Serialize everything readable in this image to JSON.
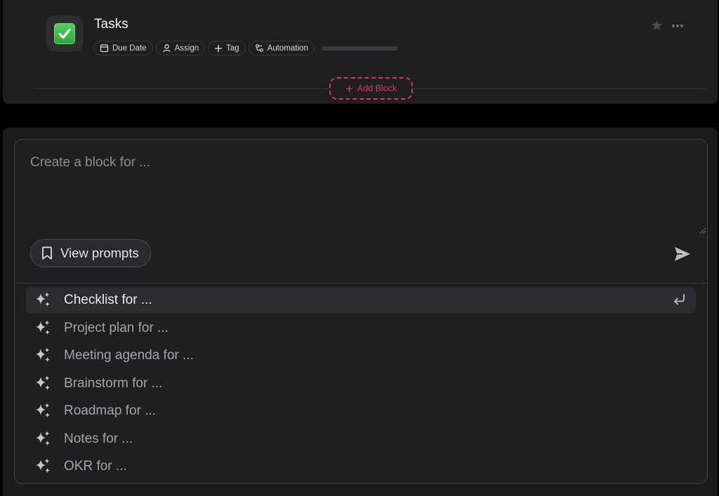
{
  "task_block": {
    "title": "Tasks",
    "chips": [
      {
        "label": "Due Date",
        "icon": "calendar-icon"
      },
      {
        "label": "Assign",
        "icon": "user-icon"
      },
      {
        "label": "Tag",
        "icon": "plus-icon"
      },
      {
        "label": "Automation",
        "icon": "automation-icon"
      }
    ],
    "add_block_label": "Add Block"
  },
  "composer": {
    "placeholder": "Create a block for ...",
    "view_prompts_label": "View prompts",
    "send_icon": "send-icon"
  },
  "suggestions": [
    {
      "label": "Checklist for ...",
      "active": true
    },
    {
      "label": "Project plan for ..."
    },
    {
      "label": "Meeting agenda for ..."
    },
    {
      "label": "Brainstorm for ..."
    },
    {
      "label": "Roadmap for ..."
    },
    {
      "label": "Notes for ..."
    },
    {
      "label": "OKR for ..."
    }
  ],
  "colors": {
    "accent_pink": "#e0336f",
    "check_green": "#3dbb48",
    "background": "#1f1f22"
  }
}
